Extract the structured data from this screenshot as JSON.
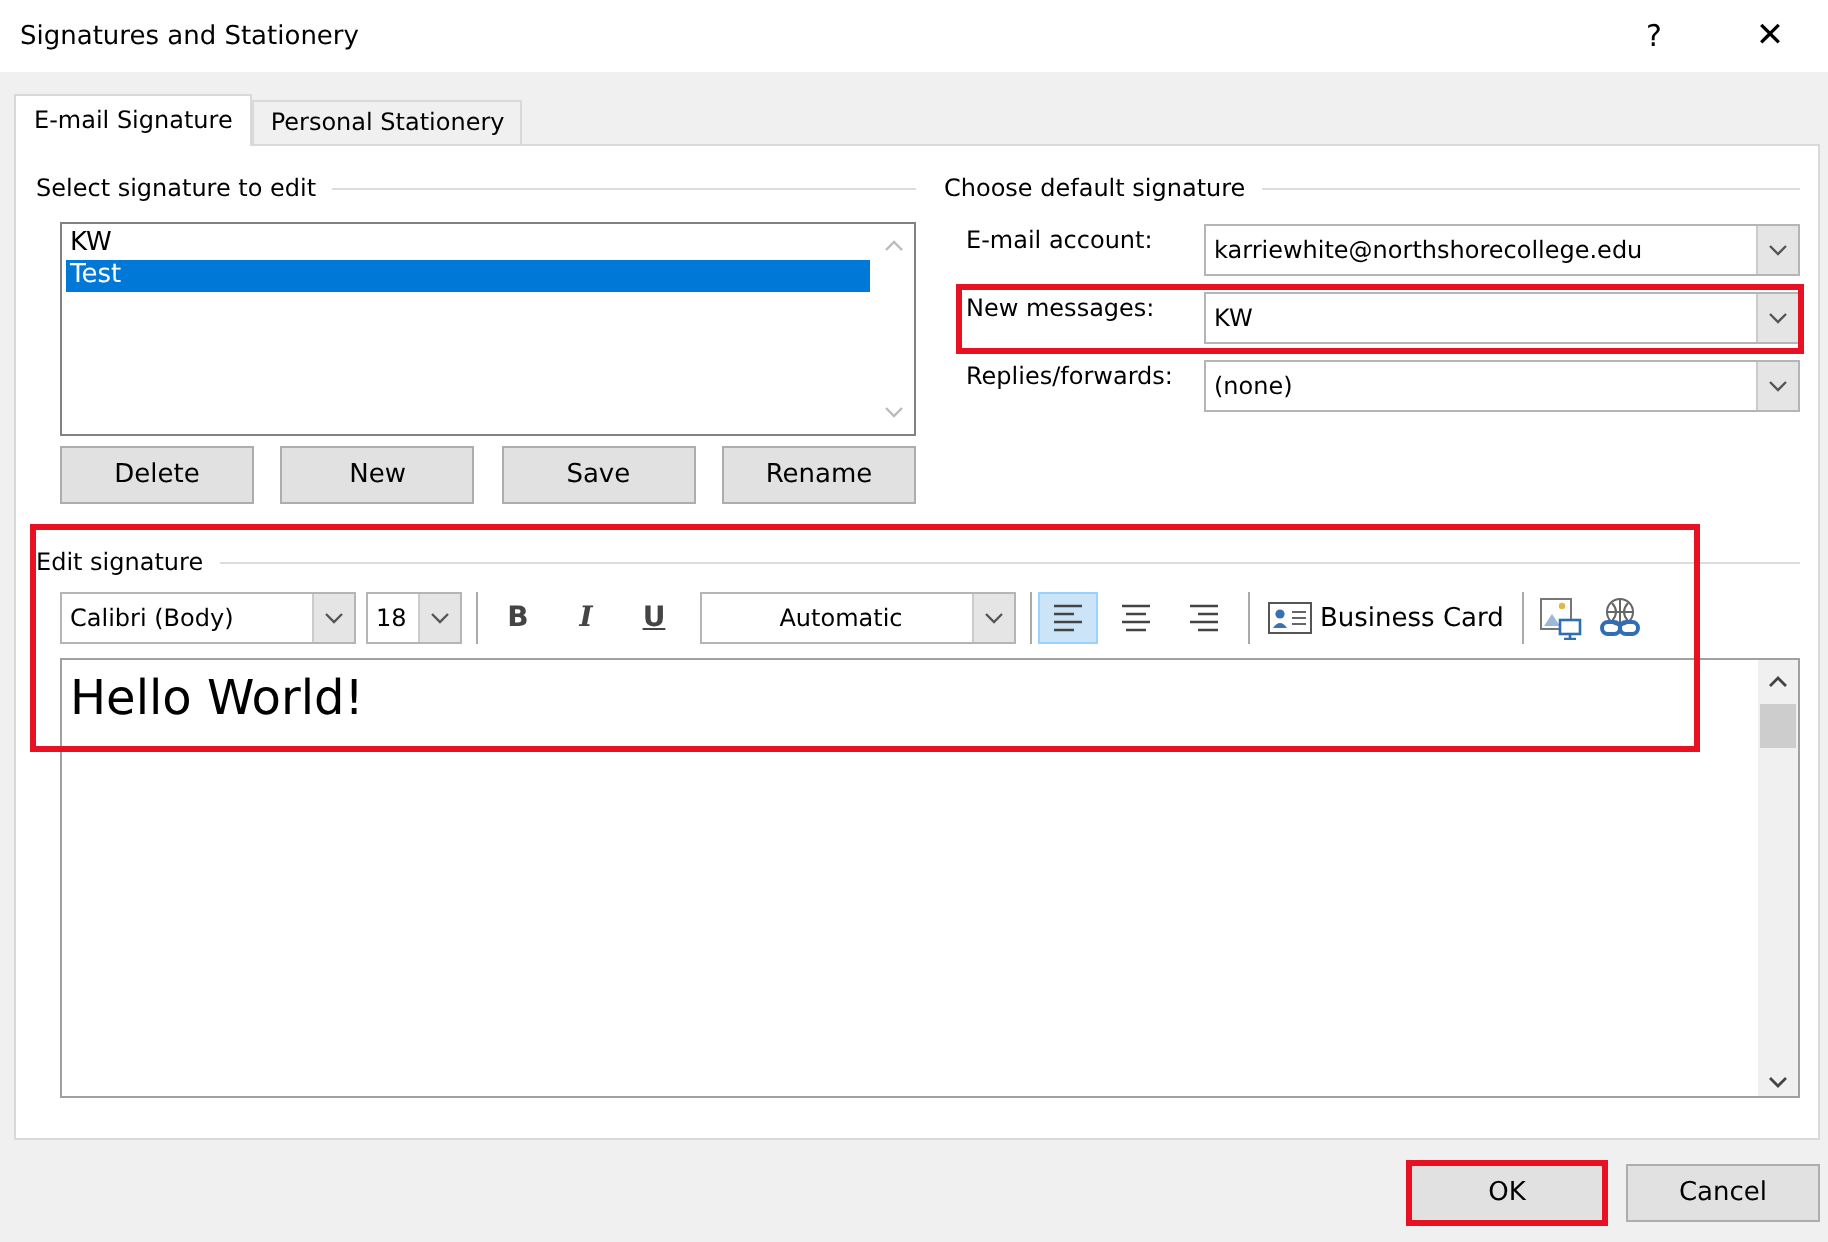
{
  "window": {
    "title": "Signatures and Stationery",
    "help": "?",
    "close": "✕"
  },
  "tabs": [
    {
      "label": "E-mail Signature",
      "selected": true
    },
    {
      "label": "Personal Stationery",
      "selected": false
    }
  ],
  "select_signature": {
    "legend": "Select signature to edit",
    "items": [
      {
        "label": "KW",
        "selected": false
      },
      {
        "label": "Test",
        "selected": true
      }
    ],
    "buttons": [
      {
        "label": "Delete"
      },
      {
        "label": "New"
      },
      {
        "label": "Save"
      },
      {
        "label": "Rename"
      }
    ]
  },
  "default_signature": {
    "legend": "Choose default signature",
    "fields": [
      {
        "label": "E-mail account:",
        "value": "karriewhite@northshorecollege.edu",
        "highlighted": false
      },
      {
        "label": "New messages:",
        "value": "KW",
        "highlighted": true
      },
      {
        "label": "Replies/forwards:",
        "value": "(none)",
        "highlighted": false
      }
    ]
  },
  "edit_signature": {
    "legend": "Edit signature",
    "highlighted": true,
    "font": "Calibri (Body)",
    "size": "18",
    "format_buttons": [
      {
        "label": "B",
        "kind": "bold"
      },
      {
        "label": "I",
        "kind": "italic"
      },
      {
        "label": "U",
        "kind": "underline"
      }
    ],
    "font_color": "Automatic",
    "align": [
      {
        "kind": "left",
        "selected": true
      },
      {
        "kind": "center",
        "selected": false
      },
      {
        "kind": "right",
        "selected": false
      }
    ],
    "business_card": {
      "label": "Business Card"
    },
    "body": "Hello World!"
  },
  "buttons": [
    {
      "label": "OK",
      "highlighted": true
    },
    {
      "label": "Cancel",
      "highlighted": false
    }
  ]
}
